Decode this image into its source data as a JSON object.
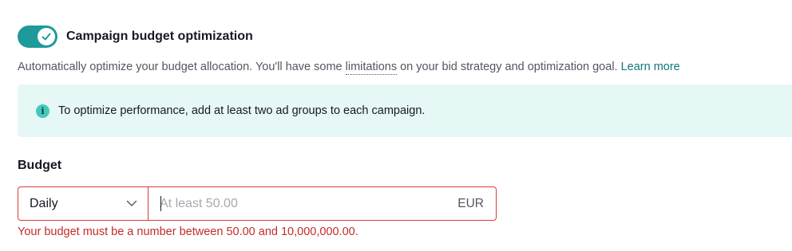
{
  "cbo": {
    "label": "Campaign budget optimization",
    "enabled": true,
    "description_before": "Automatically optimize your budget allocation. You'll have some ",
    "limitations_link": "limitations",
    "description_after": " on your bid strategy and optimization goal. ",
    "learn_more": "Learn more",
    "accent_color": "#1e9a9b"
  },
  "info": {
    "icon": "info-icon",
    "icon_glyph": "i",
    "text": "To optimize performance, add at least two ad groups to each campaign."
  },
  "budget": {
    "label": "Budget",
    "type_value": "Daily",
    "amount_value": "",
    "placeholder": "At least 50.00",
    "currency": "EUR",
    "error": "Your budget must be a number between 50.00 and 10,000,000.00.",
    "error_color": "#c32b2a"
  }
}
